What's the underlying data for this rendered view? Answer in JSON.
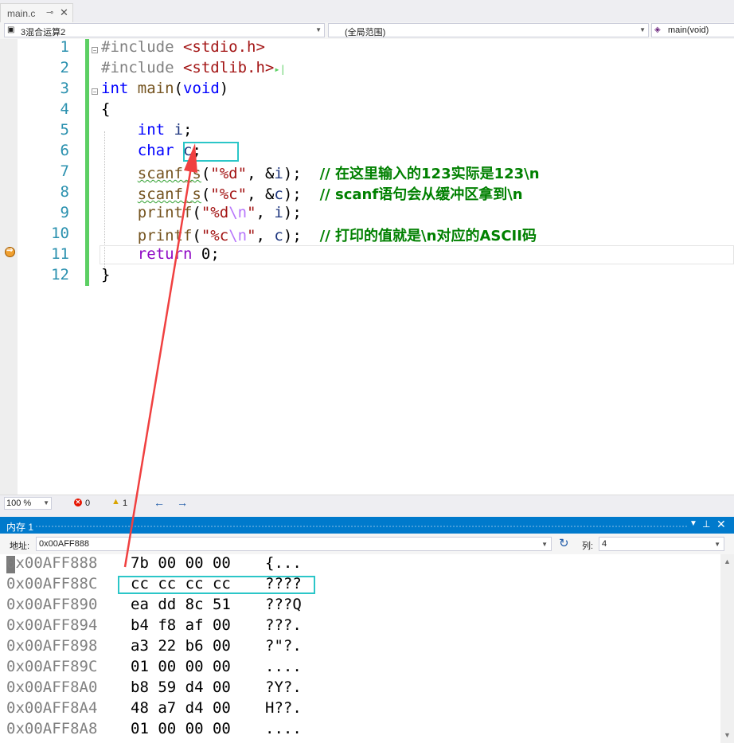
{
  "tab": {
    "label": "main.c",
    "pin": "⊸",
    "close": "✕"
  },
  "navbar": {
    "project": "3混合运算2",
    "scope": "(全局范围)",
    "function": "main(void)"
  },
  "editor": {
    "line_numbers": [
      "1",
      "2",
      "3",
      "4",
      "5",
      "6",
      "7",
      "8",
      "9",
      "10",
      "11",
      "12"
    ],
    "current_line": "11"
  },
  "status": {
    "zoom": "100 %",
    "errors": "0",
    "warnings": "1"
  },
  "memory": {
    "title": "内存 1",
    "address_label": "地址:",
    "address_value": "0x00AFF888",
    "columns_label": "列:",
    "columns_value": "4",
    "rows": [
      {
        "addr": "0x00AFF888",
        "bytes": "7b 00 00 00",
        "ascii": "{..."
      },
      {
        "addr": "0x00AFF88C",
        "bytes": "cc cc cc cc",
        "ascii": "????"
      },
      {
        "addr": "0x00AFF890",
        "bytes": "ea dd 8c 51",
        "ascii": "???Q"
      },
      {
        "addr": "0x00AFF894",
        "bytes": "b4 f8 af 00",
        "ascii": "???."
      },
      {
        "addr": "0x00AFF898",
        "bytes": "a3 22 b6 00",
        "ascii": "?\"?."
      },
      {
        "addr": "0x00AFF89C",
        "bytes": "01 00 00 00",
        "ascii": "...."
      },
      {
        "addr": "0x00AFF8A0",
        "bytes": "b8 59 d4 00",
        "ascii": "?Y?."
      },
      {
        "addr": "0x00AFF8A4",
        "bytes": "48 a7 d4 00",
        "ascii": "H??."
      },
      {
        "addr": "0x00AFF8A8",
        "bytes": "01 00 00 00",
        "ascii": "...."
      }
    ]
  },
  "code": {
    "l1_pp": "#include",
    "l1_inc": "<stdio.h>",
    "l2_pp": "#include",
    "l2_inc": "<stdlib.h>",
    "l3_kw": "int",
    "l3_fn": "main",
    "l3_kw2": "void",
    "l4": "{",
    "l5_kw": "int",
    "l5_var": "i",
    "l6_kw": "char",
    "l6_var": "c",
    "l7_fn": "scanf_s",
    "l7_str": "\"%d\"",
    "l7_var": "i",
    "l7_cmt": "// 在这里输入的123实际是123\\n",
    "l8_fn": "scanf_s",
    "l8_str": "\"%c\"",
    "l8_var": "c",
    "l8_cmt": "// scanf语句会从缓冲区拿到\\n",
    "l9_fn": "printf",
    "l9_str_a": "\"%d",
    "l9_esc": "\\n",
    "l9_str_b": "\"",
    "l9_var": "i",
    "l10_fn": "printf",
    "l10_str_a": "\"%c",
    "l10_esc": "\\n",
    "l10_str_b": "\"",
    "l10_var": "c",
    "l10_cmt": "// 打印的值就是\\n对应的ASCII码",
    "l11_ret": "return",
    "l11_num": "0",
    "l12": "}"
  },
  "colors": {
    "accent": "#007acc",
    "highlight_box": "#2bc6c8",
    "annotation_arrow": "#f04040",
    "change_bar": "#5ccf63"
  }
}
